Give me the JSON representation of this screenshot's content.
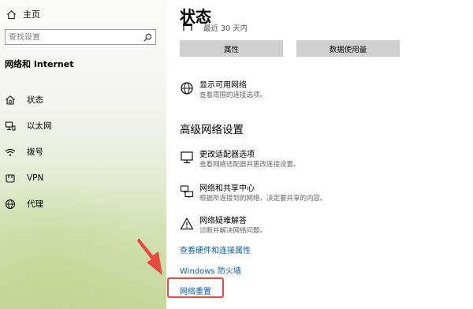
{
  "sidebar": {
    "home_label": "主页",
    "search_placeholder": "查找设置",
    "section_title": "网络和 Internet",
    "items": [
      {
        "label": "状态",
        "icon": "home-globe-icon"
      },
      {
        "label": "以太网",
        "icon": "ethernet-icon"
      },
      {
        "label": "拨号",
        "icon": "dialup-icon"
      },
      {
        "label": "VPN",
        "icon": "vpn-icon"
      },
      {
        "label": "代理",
        "icon": "globe-icon"
      }
    ]
  },
  "main": {
    "title": "状态",
    "usage_text": "最近 30 天内",
    "buttons": {
      "properties": "属性",
      "data_usage": "数据使用量"
    },
    "show_networks": {
      "title": "显示可用网络",
      "desc": "查看周围的连接选项。"
    },
    "advanced_heading": "高级网络设置",
    "options": [
      {
        "title": "更改适配器选项",
        "desc": "查看网络适配器并更改连接设置。",
        "icon": "adapter-monitor-icon"
      },
      {
        "title": "网络和共享中心",
        "desc": "根据所连接到的网络，决定要共享的内容。",
        "icon": "sharing-center-icon"
      },
      {
        "title": "网络疑难解答",
        "desc": "诊断并解决网络问题。",
        "icon": "warning-icon"
      }
    ],
    "links": {
      "hardware": "查看硬件和连接属性",
      "firewall": "Windows 防火墙",
      "reset": "网络重置"
    }
  },
  "colors": {
    "accent_link": "#0a5fb4",
    "highlight": "#e8483e",
    "button_bg": "#cfcfcf"
  }
}
